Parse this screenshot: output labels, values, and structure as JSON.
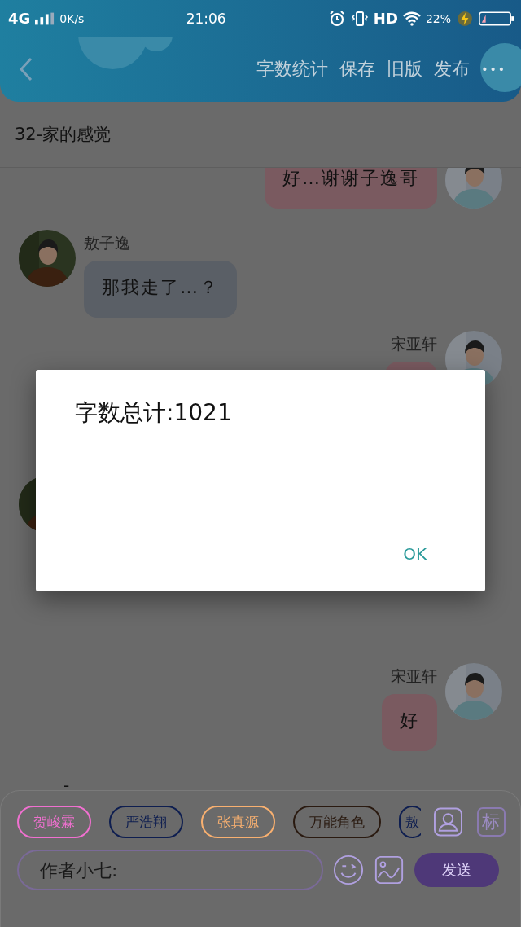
{
  "status_bar": {
    "network": "4G",
    "speed": "0K/s",
    "time": "21:06",
    "hd": "HD",
    "battery": "22%"
  },
  "header": {
    "actions": [
      "字数统计",
      "保存",
      "旧版",
      "发布"
    ],
    "more": "•••"
  },
  "chapter_title": "32-家的感觉",
  "messages": [
    {
      "kind": "right",
      "text": "好…谢谢子逸哥"
    },
    {
      "kind": "left",
      "name": "敖子逸",
      "text": "那我走了…？"
    },
    {
      "kind": "right",
      "name": "宋亚轩"
    },
    {
      "kind": "left"
    },
    {
      "kind": "right",
      "name": "宋亚轩",
      "text": "好"
    },
    {
      "kind": "narration",
      "text": "-"
    }
  ],
  "dialog": {
    "title": "字数总计:1021",
    "button": "OK"
  },
  "chips": [
    {
      "label": "贺峻霖",
      "color": "#f070d0"
    },
    {
      "label": "严浩翔",
      "color": "#0e1e50"
    },
    {
      "label": "张真源",
      "color": "#f8b070"
    },
    {
      "label": "万能角色",
      "color": "#2a1a10"
    },
    {
      "label": "敖",
      "color": "#0e1e50"
    }
  ],
  "tag_key": "标",
  "input": {
    "placeholder": "作者小七:"
  },
  "send": "发送"
}
